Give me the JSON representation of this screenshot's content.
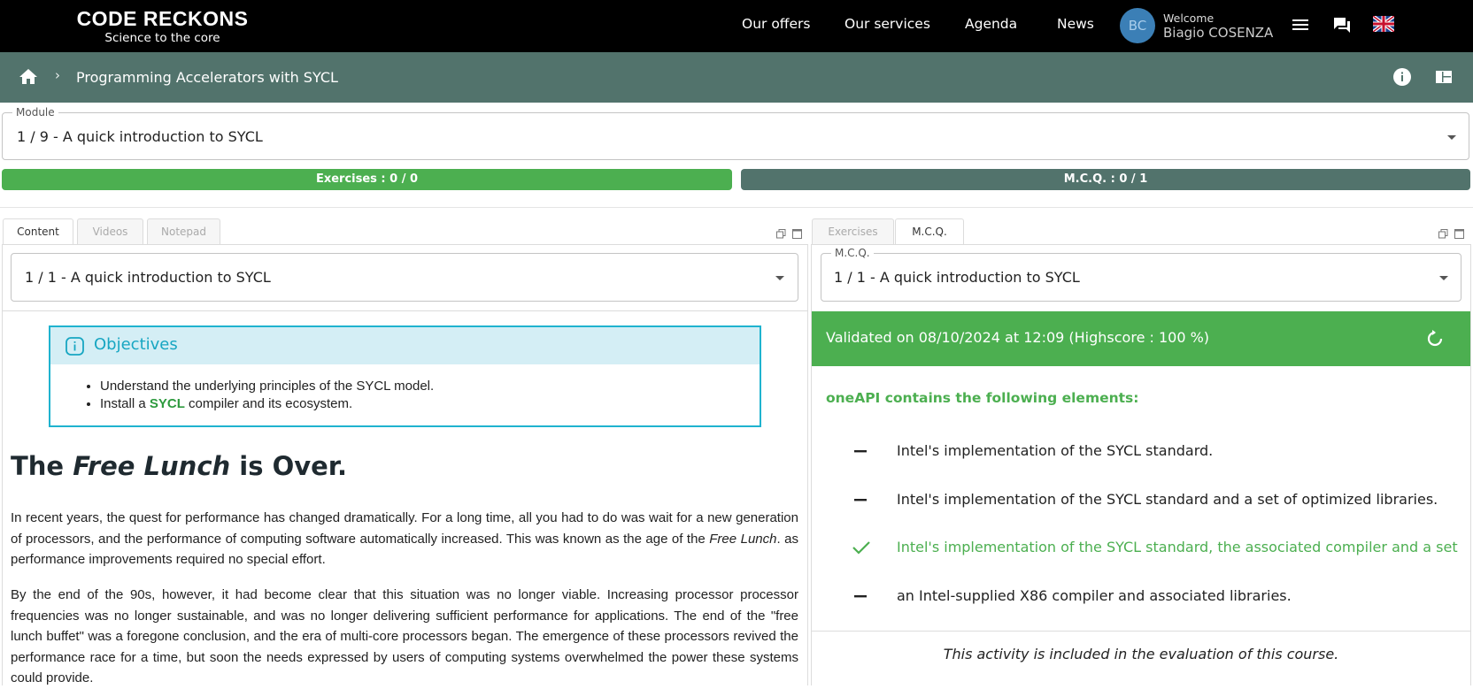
{
  "brand": {
    "name": "CODE RECKONS",
    "tagline": "Science to the core"
  },
  "nav": {
    "links": [
      "Our offers",
      "Our services",
      "Agenda",
      "News"
    ],
    "avatar_initials": "BC",
    "welcome_label": "Welcome",
    "user_name": "Biagio COSENZA",
    "icons": [
      "menu-icon",
      "chat-icon",
      "uk-flag-icon"
    ]
  },
  "breadcrumb": {
    "separator": "›",
    "title": "Programming Accelerators with SYCL"
  },
  "module_select": {
    "label": "Module",
    "value": "1 / 9 - A quick introduction to SYCL"
  },
  "progress": {
    "exercises_label": "Exercises : 0 / 0",
    "mcq_label": "M.C.Q. : 0 / 1",
    "exercises_color": "#4caf50",
    "mcq_color": "#52736c"
  },
  "left_panel": {
    "tabs": [
      "Content",
      "Videos",
      "Notepad"
    ],
    "active_tab": "Content",
    "select_value": "1 / 1 - A quick introduction to SYCL",
    "objectives": {
      "title": "Objectives",
      "item1": "Understand the underlying principles of the SYCL model.",
      "item2_pre": "Install a ",
      "item2_highlight": "SYCL",
      "item2_post": " compiler and its ecosystem."
    },
    "article": {
      "title_pre": "The ",
      "title_em": "Free Lunch",
      "title_post": " is Over.",
      "p1_text": "In recent years, the quest for performance has changed dramatically. For a long time, all you had to do was wait for a new generation of processors, and the performance of computing software automatically increased. This was known as the age of the ",
      "p1_em": "Free Lunch",
      "p1_tail": ". as performance improvements required no special effort.",
      "p2": "By the end of the 90s, however, it had become clear that this situation was no longer viable. Increasing processor processor frequencies was no longer sustainable, and was no longer delivering sufficient performance for applications. The end of the \"free lunch buffet\" was a foregone conclusion, and the era of multi-core processors began. The emergence of these processors revived the performance race for a time, but soon the needs expressed by users of computing systems overwhelmed the power these systems could provide."
    }
  },
  "right_panel": {
    "tabs": [
      "Exercises",
      "M.C.Q."
    ],
    "active_tab": "M.C.Q.",
    "select_label": "M.C.Q.",
    "select_value": "1 / 1 - A quick introduction to SYCL",
    "validated": "Validated on 08/10/2024 at 12:09 (Highscore : 100 %)",
    "question": "oneAPI contains the following elements:",
    "answers": [
      {
        "text": "Intel's implementation of the SYCL standard.",
        "correct": false
      },
      {
        "text": "Intel's implementation of the SYCL standard and a set of optimized libraries.",
        "correct": false
      },
      {
        "text": "Intel's implementation of the SYCL standard, the associated compiler and a set o",
        "correct": true
      },
      {
        "text": "an Intel-supplied X86 compiler and associated libraries.",
        "correct": false
      }
    ],
    "note": "This activity is included in the evaluation of this course."
  }
}
